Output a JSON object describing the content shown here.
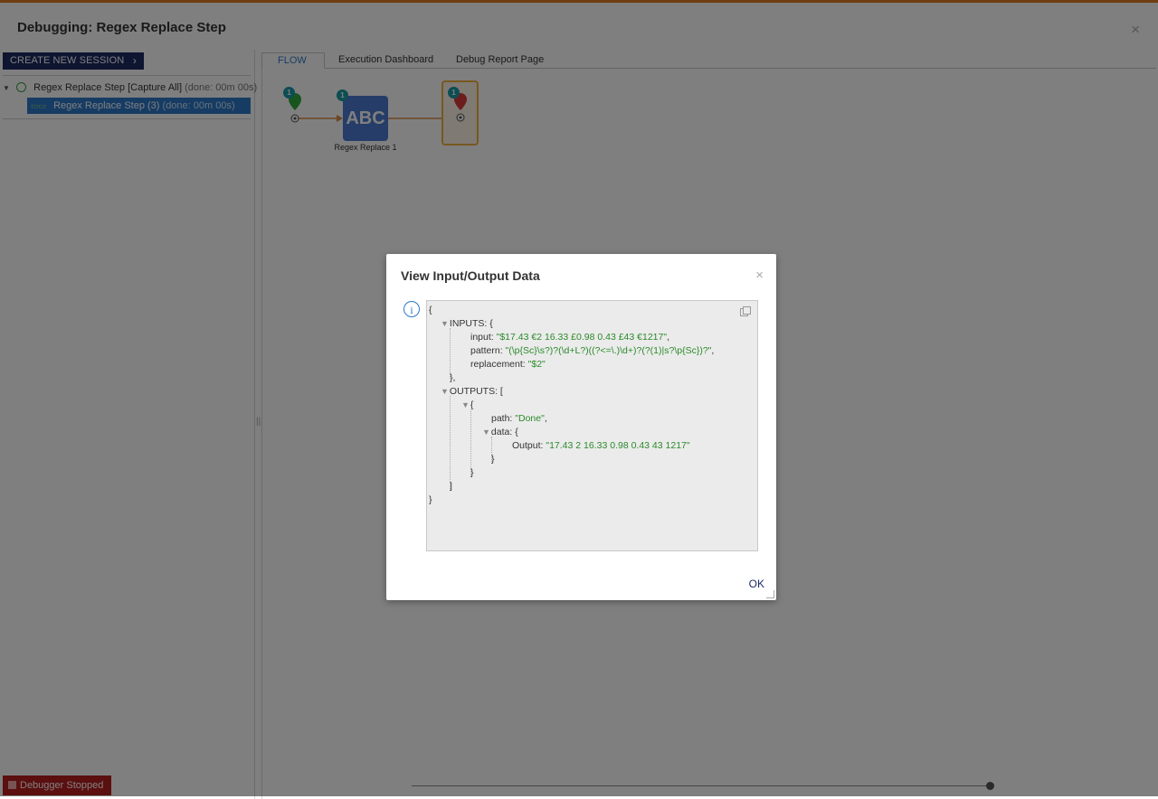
{
  "window": {
    "title": "Debugging: Regex Replace Step",
    "close_icon": "×"
  },
  "left_panel": {
    "create_session_label": "CREATE NEW SESSION",
    "create_session_chevron": "›",
    "tree": [
      {
        "label": "Regex Replace Step [Capture All]",
        "status": "(done: 00m 00s)",
        "arrow": "▼"
      },
      {
        "label": "Regex Replace Step (3)",
        "status": "(done: 00m 00s)"
      }
    ],
    "debugger_status": "Debugger Stopped"
  },
  "tabs": [
    {
      "label": "FLOW",
      "active": true
    },
    {
      "label": "Execution Dashboard",
      "active": false
    },
    {
      "label": "Debug Report Page",
      "active": false
    }
  ],
  "flow": {
    "start_badge": "1",
    "step_badge": "1",
    "step_icon_text": "ABC",
    "step_label": "Regex Replace 1",
    "end_badge": "1"
  },
  "modal": {
    "title": "View Input/Output Data",
    "close_icon": "×",
    "info_icon": "i",
    "ok_label": "OK",
    "lines": {
      "open_brace": "{",
      "inputs_key": "INPUTS: {",
      "input_key": "input: ",
      "input_val": "\"$17.43 €2 16.33 £0.98 0.43 £43 €1217\"",
      "input_comma": ",",
      "pattern_key": "pattern: ",
      "pattern_val": "\"(\\p{Sc}\\s?)?(\\d+L?)((?<=\\.)\\d+)?(?(1)|s?\\p{Sc})?\"",
      "pattern_comma": ",",
      "replacement_key": "replacement: ",
      "replacement_val": "\"$2\"",
      "inputs_close": "},",
      "outputs_key": "OUTPUTS: [",
      "obj_open": "{",
      "path_key": "path: ",
      "path_val": "\"Done\"",
      "path_comma": ",",
      "data_key": "data: {",
      "output_key": "Output: ",
      "output_val": "\"17.43 2 16.33 0.98 0.43 43 1217\"",
      "data_close": "}",
      "obj_close": "}",
      "outputs_close": "]",
      "close_brace": "}"
    }
  }
}
